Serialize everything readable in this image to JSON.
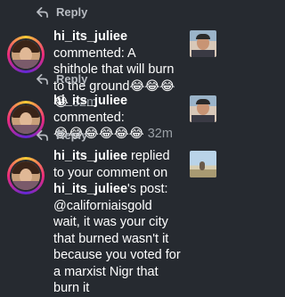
{
  "top_reply": {
    "label": "Reply"
  },
  "notifications": [
    {
      "username": "hi_its_juliee",
      "text_before_emoji": " commented: A shithole that will burn to the ground",
      "emoji": "😂😂😂😂",
      "time": "32m",
      "reply_label": "Reply",
      "thumbnail_icon": "selfie-thumbnail"
    },
    {
      "username": "hi_its_juliee",
      "text_before_emoji": " commented:",
      "emoji": "😂😂😂😂😂😂",
      "time": "32m",
      "reply_label": "Reply",
      "thumbnail_icon": "selfie-thumbnail"
    },
    {
      "username": "hi_its_juliee",
      "text_before_mention": " replied to your comment on ",
      "post_owner": "hi_its_juliee",
      "text_after_mention": "'s post: @californiaisgold wait, it was your city that burned wasn't it because you voted for a marxist Nigr that burn it",
      "thumbnail_icon": "landscape-thumbnail"
    }
  ],
  "colors": {
    "background": "#262a30",
    "text": "#ffffff",
    "secondary_text": "#9aa0a6",
    "reply_text": "#b8bcc2"
  }
}
